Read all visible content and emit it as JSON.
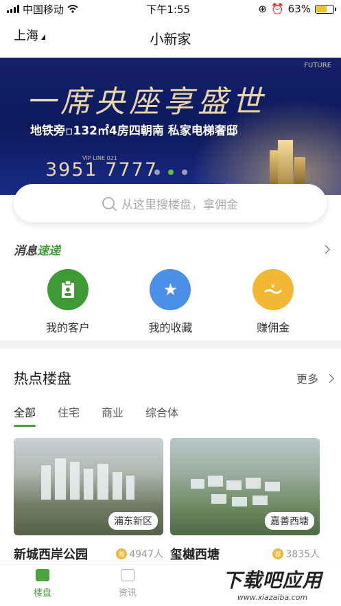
{
  "status_bar": {
    "carrier": "中国移动",
    "time": "下午1:55",
    "battery": "63%"
  },
  "nav": {
    "city": "上海",
    "title": "小新家"
  },
  "banner": {
    "headline": "一席央座享盛世",
    "subtitle": "地铁旁▫132㎡4房四朝南 私家电梯奢邸",
    "phone_label": "VIP LINE 021",
    "phone": "3951 7777",
    "brand": "FUTURE",
    "slide_count": 3,
    "active_slide": 2
  },
  "search": {
    "placeholder": "从这里搜楼盘，拿佣金"
  },
  "news": {
    "logo_a": "消息",
    "logo_b": "速递"
  },
  "shortcuts": [
    {
      "label": "我的客户",
      "icon": "clipboard-icon",
      "color": "#3d9a34"
    },
    {
      "label": "我的收藏",
      "icon": "star-icon",
      "color": "#4b8fe8"
    },
    {
      "label": "赚佣金",
      "icon": "hand-money-icon",
      "color": "#f2b733"
    }
  ],
  "hot": {
    "title": "热点楼盘",
    "more": "更多",
    "tabs": [
      "全部",
      "住宅",
      "商业",
      "综合体"
    ],
    "active_tab": 0,
    "cards": [
      {
        "name": "新城西岸公园",
        "area": "浦东新区",
        "count": "4947人",
        "badge": "荐"
      },
      {
        "name": "玺樾西塘",
        "area": "嘉善西塘",
        "count": "3835人",
        "badge": "荐"
      }
    ]
  },
  "tabbar": [
    {
      "label": "楼盘",
      "active": true
    },
    {
      "label": "资讯",
      "active": false
    }
  ],
  "watermark": {
    "big": "下载吧应用",
    "small": "www.xiazaiba.com"
  },
  "colors": {
    "accent": "#4aa33d",
    "banner_bg": "#15206a"
  }
}
